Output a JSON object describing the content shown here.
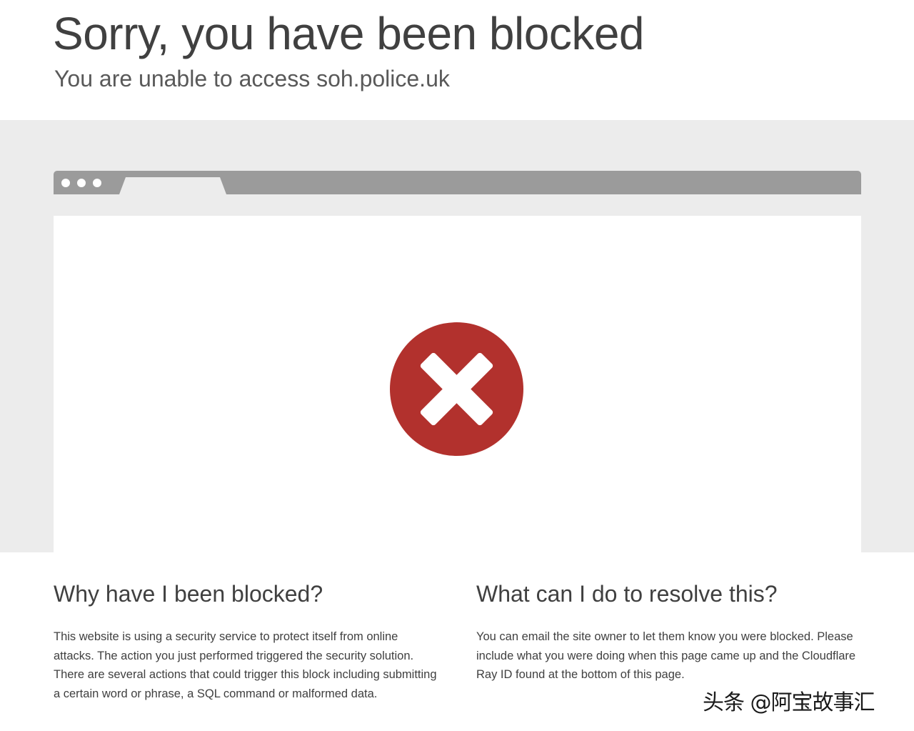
{
  "header": {
    "title": "Sorry, you have been blocked",
    "subtitle": "You are unable to access soh.police.uk"
  },
  "browser_illustration": {
    "error_icon": "error-x-circle-icon",
    "error_color": "#b2312d"
  },
  "why_blocked": {
    "heading": "Why have I been blocked?",
    "body": "This website is using a security service to protect itself from online attacks. The action you just performed triggered the security solution. There are several actions that could trigger this block including submitting a certain word or phrase, a SQL command or malformed data."
  },
  "resolve": {
    "heading": "What can I do to resolve this?",
    "body": "You can email the site owner to let them know you were blocked. Please include what you were doing when this page came up and the Cloudflare Ray ID found at the bottom of this page."
  },
  "watermark": "头条 @阿宝故事汇"
}
